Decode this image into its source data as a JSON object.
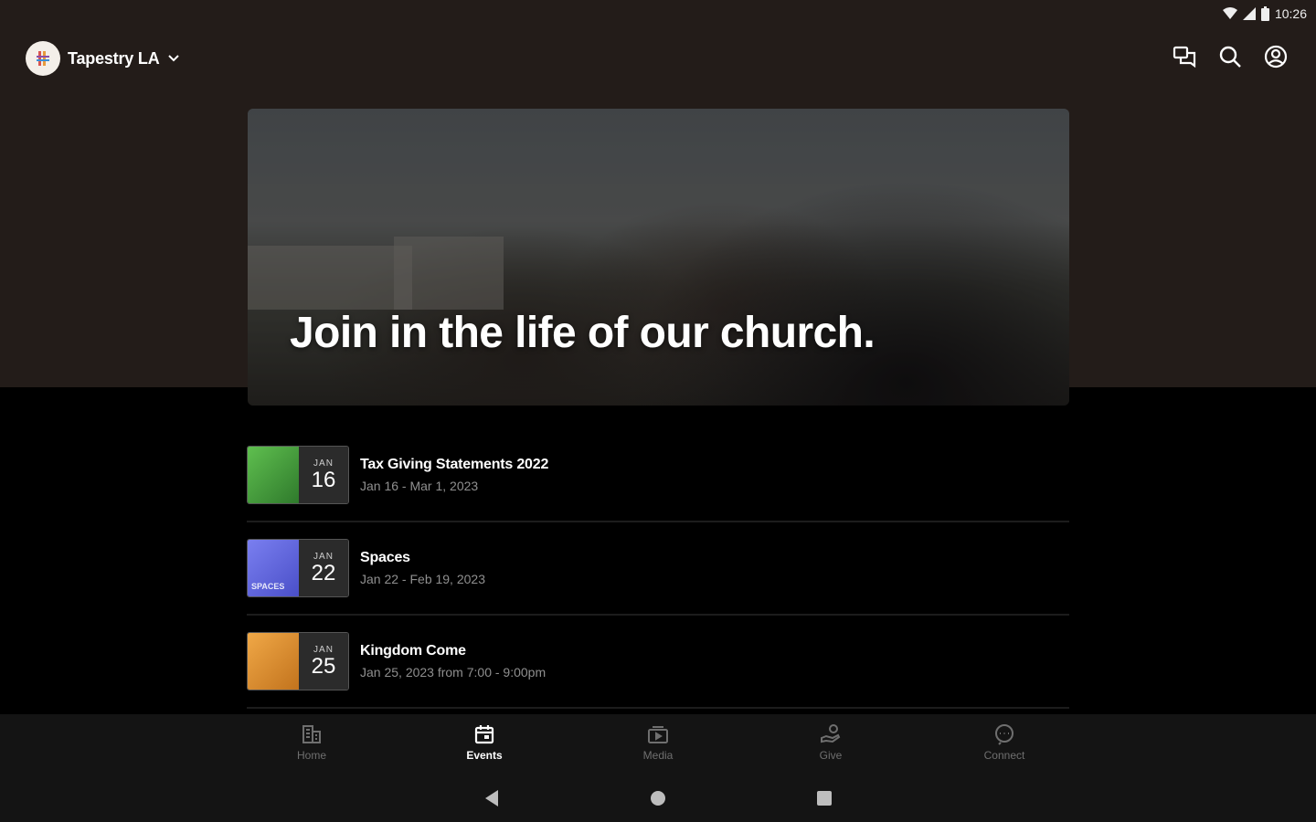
{
  "status_bar": {
    "time": "10:26"
  },
  "header": {
    "church_name": "Tapestry LA",
    "icons": [
      "chat-icon",
      "search-icon",
      "account-icon"
    ]
  },
  "hero": {
    "title": "Join in the life of our church."
  },
  "events": [
    {
      "title": "Tax Giving Statements 2022",
      "date": "Jan 16 - Mar 1, 2023",
      "month": "JAN",
      "day": "16",
      "thumb_color": "#3e8f3a"
    },
    {
      "title": "Spaces",
      "date": "Jan 22 - Feb 19, 2023",
      "month": "JAN",
      "day": "22",
      "thumb_color": "#5a5fd6",
      "thumb_text": "SPACES"
    },
    {
      "title": "Kingdom Come",
      "date": "Jan 25, 2023 from 7:00 - 9:00pm",
      "month": "JAN",
      "day": "25",
      "thumb_color": "#d98a2b"
    }
  ],
  "bottom_nav": [
    {
      "label": "Home",
      "icon": "home-icon",
      "active": false
    },
    {
      "label": "Events",
      "icon": "calendar-icon",
      "active": true
    },
    {
      "label": "Media",
      "icon": "media-icon",
      "active": false
    },
    {
      "label": "Give",
      "icon": "give-icon",
      "active": false
    },
    {
      "label": "Connect",
      "icon": "connect-icon",
      "active": false
    }
  ],
  "colors": {
    "header_bg": "#231c19",
    "list_bg": "#000000",
    "nav_bg": "#141414",
    "inactive_label": "#6f6f6f"
  }
}
